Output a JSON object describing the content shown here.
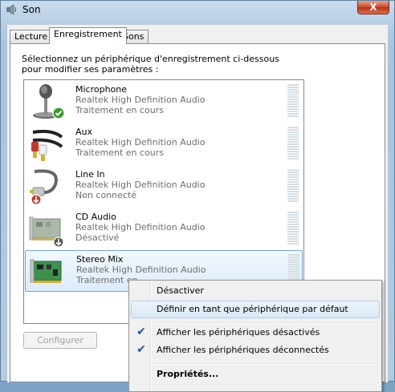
{
  "window": {
    "title": "Son",
    "close_glyph": "X"
  },
  "tabs": [
    {
      "label": "Lecture",
      "active": false
    },
    {
      "label": "Enregistrement",
      "active": true
    },
    {
      "label": "Sons",
      "active": false
    }
  ],
  "instruction": "Sélectionnez un périphérique d'enregistrement ci-dessous pour modifier ses paramètres :",
  "devices": [
    {
      "name": "Microphone",
      "driver": "Realtek High Definition Audio",
      "status": "Traitement en cours",
      "icon": "microphone-icon",
      "badge": "green-check-badge"
    },
    {
      "name": "Aux",
      "driver": "Realtek High Definition Audio",
      "status": "Traitement en cours",
      "icon": "rca-cable-icon",
      "badge": ""
    },
    {
      "name": "Line In",
      "driver": "Realtek High Definition Audio",
      "status": "Non connecté",
      "icon": "jack-cable-icon",
      "badge": "red-down-arrow-badge"
    },
    {
      "name": "CD Audio",
      "driver": "Realtek High Definition Audio",
      "status": "Désactivé",
      "icon": "sound-card-icon",
      "badge": "gray-down-arrow-badge"
    },
    {
      "name": "Stereo Mix",
      "driver": "Realtek High Definition Audio",
      "status": "Traitement en",
      "icon": "sound-card-icon",
      "badge": "",
      "selected": true
    }
  ],
  "buttons": {
    "configure": "Configurer"
  },
  "context_menu": {
    "items": [
      {
        "label": "Désactiver",
        "checked": false,
        "bold": false,
        "highlighted": false
      },
      {
        "label": "Définir en tant que périphérique par défaut",
        "checked": false,
        "bold": false,
        "highlighted": true
      },
      {
        "label": "Afficher les périphériques désactivés",
        "checked": true,
        "bold": false,
        "highlighted": false
      },
      {
        "label": "Afficher les périphériques déconnectés",
        "checked": true,
        "bold": false,
        "highlighted": false
      },
      {
        "label": "Propriétés...",
        "checked": false,
        "bold": true,
        "highlighted": false
      }
    ]
  },
  "colors": {
    "accent": "#1f52b3",
    "selection_border": "#7da2ce",
    "disabled_text": "#a0a0a0"
  }
}
